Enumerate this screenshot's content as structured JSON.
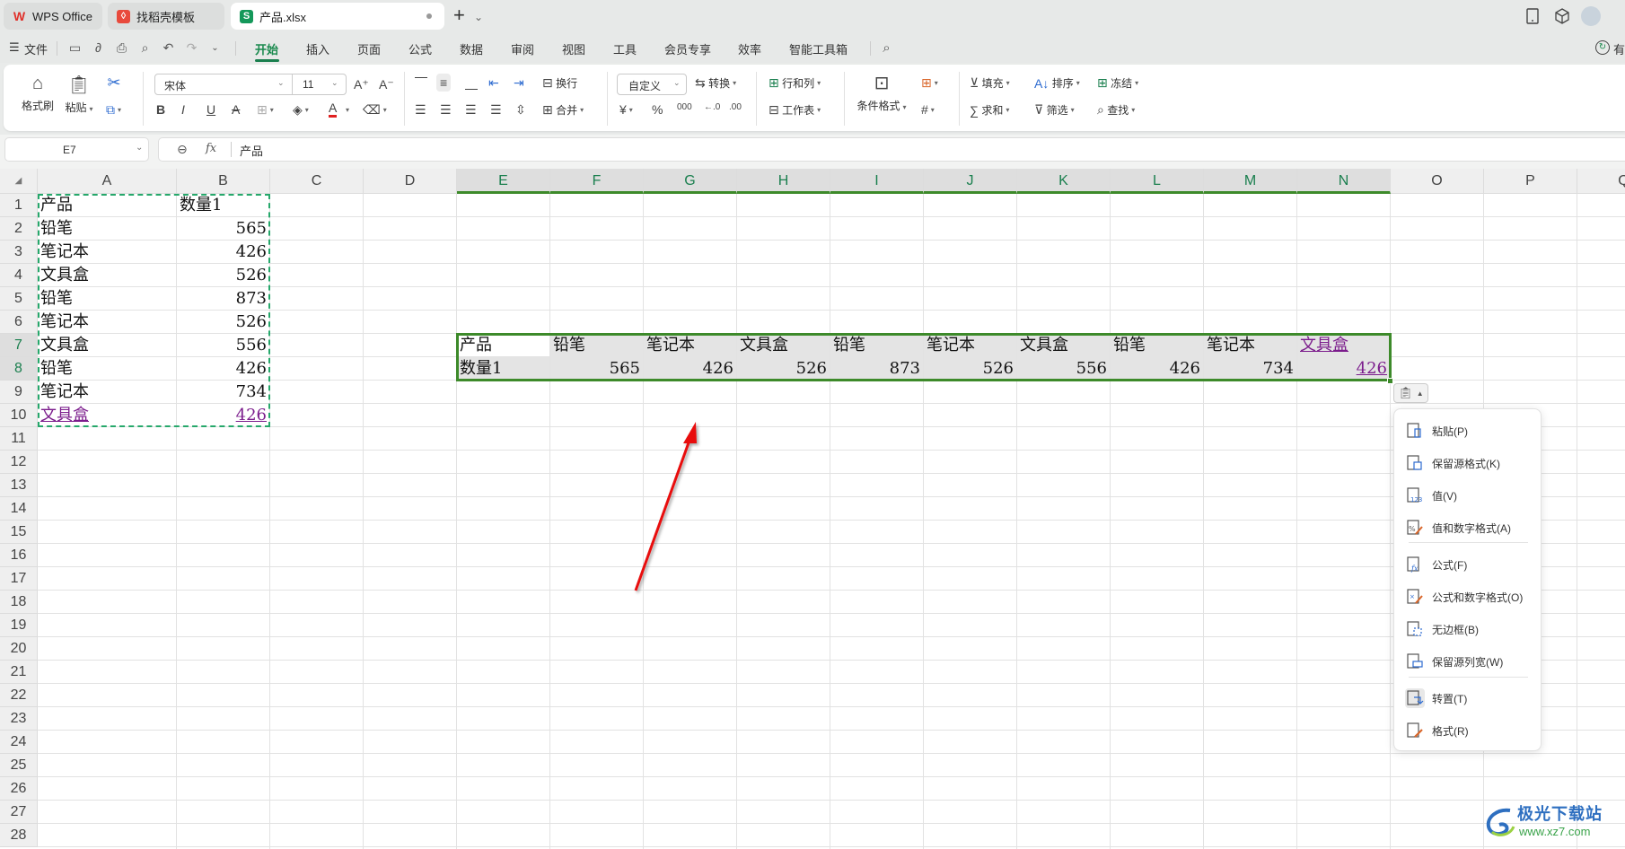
{
  "titlebar": {
    "tabs": [
      {
        "label": "WPS Office",
        "icon": "wps-logo-icon",
        "active": false
      },
      {
        "label": "找稻壳模板",
        "icon": "docer-icon",
        "active": false
      },
      {
        "label": "产品.xlsx",
        "icon": "spreadsheet-icon",
        "active": true
      }
    ],
    "new_tab": "+",
    "dropdown": "⌄"
  },
  "menubar": {
    "file_label": "文件",
    "tabs": [
      "开始",
      "插入",
      "页面",
      "公式",
      "数据",
      "审阅",
      "视图",
      "工具",
      "会员专享",
      "效率",
      "智能工具箱"
    ],
    "active_tab": "开始",
    "share_label": "有"
  },
  "ribbon": {
    "format_painter": "格式刷",
    "paste": "粘贴",
    "font_name": "宋体",
    "font_size": "11",
    "wrap": "换行",
    "merge": "合并",
    "number_format": "自定义",
    "convert": "转换",
    "rows_cols": "行和列",
    "worksheet": "工作表",
    "cond_format": "条件格式",
    "fill": "填充",
    "sort": "排序",
    "freeze": "冻结",
    "sum": "求和",
    "filter": "筛选",
    "find": "查找",
    "colors": {
      "font_color": "#e02020",
      "accent": "#1a7f4e"
    }
  },
  "formula_bar": {
    "cell_ref": "E7",
    "fx": "fx",
    "value": "产品"
  },
  "grid": {
    "columns": [
      "A",
      "B",
      "C",
      "D",
      "E",
      "F",
      "G",
      "H",
      "I",
      "J",
      "K",
      "L",
      "M",
      "N",
      "O",
      "P",
      "Q"
    ],
    "selected_columns": [
      "E",
      "F",
      "G",
      "H",
      "I",
      "J",
      "K",
      "L",
      "M",
      "N"
    ],
    "rows": [
      "1",
      "2",
      "3",
      "4",
      "5",
      "6",
      "7",
      "8",
      "9",
      "10",
      "11",
      "12",
      "13",
      "14",
      "15",
      "16",
      "17",
      "18",
      "19",
      "20",
      "21",
      "22",
      "23",
      "24",
      "25",
      "26",
      "27",
      "28"
    ],
    "selected_rows": [
      "7",
      "8"
    ],
    "source": {
      "header": [
        "产品",
        "数量1"
      ],
      "rows": [
        [
          "铅笔",
          "565"
        ],
        [
          "笔记本",
          "426"
        ],
        [
          "文具盒",
          "526"
        ],
        [
          "铅笔",
          "873"
        ],
        [
          "笔记本",
          "526"
        ],
        [
          "文具盒",
          "556"
        ],
        [
          "铅笔",
          "426"
        ],
        [
          "笔记本",
          "734"
        ],
        [
          "文具盒",
          "426"
        ]
      ]
    },
    "transposed": {
      "row7": [
        "产品",
        "铅笔",
        "笔记本",
        "文具盒",
        "铅笔",
        "笔记本",
        "文具盒",
        "铅笔",
        "笔记本",
        "文具盒"
      ],
      "row8": [
        "数量1",
        "565",
        "426",
        "526",
        "873",
        "526",
        "556",
        "426",
        "734",
        "426"
      ]
    },
    "link_color": "#7b1c8c",
    "selection_color": "#3d8a2a",
    "copy_border_color": "#26a86b"
  },
  "paste_menu": {
    "items": [
      {
        "label": "粘贴(P)",
        "icon": "paste-icon"
      },
      {
        "label": "保留源格式(K)",
        "icon": "keep-source-format-icon"
      },
      {
        "label": "值(V)",
        "icon": "paste-values-icon"
      },
      {
        "label": "值和数字格式(A)",
        "icon": "values-number-format-icon"
      },
      {
        "label": "公式(F)",
        "icon": "paste-formula-icon"
      },
      {
        "label": "公式和数字格式(O)",
        "icon": "formula-number-format-icon"
      },
      {
        "label": "无边框(B)",
        "icon": "no-borders-icon"
      },
      {
        "label": "保留源列宽(W)",
        "icon": "keep-column-width-icon"
      },
      {
        "label": "转置(T)",
        "icon": "transpose-icon",
        "highlighted": true
      },
      {
        "label": "格式(R)",
        "icon": "paste-format-icon"
      }
    ]
  },
  "watermark": {
    "title": "极光下载站",
    "url": "www.xz7.com"
  }
}
